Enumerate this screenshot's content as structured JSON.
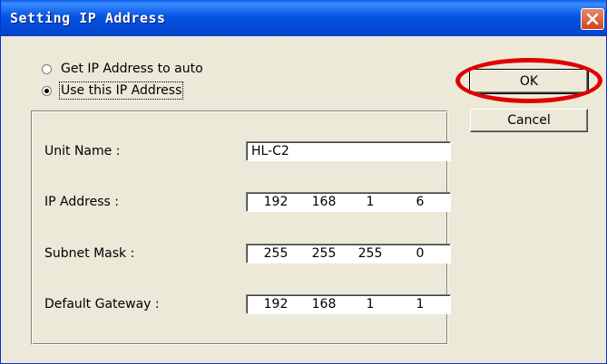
{
  "window": {
    "title": "Setting IP Address"
  },
  "mode": {
    "auto_label": "Get IP Address to auto",
    "manual_label": "Use this IP Address",
    "selected": "manual"
  },
  "fields": {
    "unit_name": {
      "label": "Unit Name :",
      "value": "HL-C2"
    },
    "ip_address": {
      "label": "IP Address :",
      "octets": [
        "192",
        "168",
        "1",
        "6"
      ]
    },
    "subnet_mask": {
      "label": "Subnet Mask :",
      "octets": [
        "255",
        "255",
        "255",
        "0"
      ]
    },
    "default_gateway": {
      "label": "Default Gateway :",
      "octets": [
        "192",
        "168",
        "1",
        "1"
      ]
    }
  },
  "buttons": {
    "ok": "OK",
    "cancel": "Cancel"
  },
  "annotation": {
    "highlight_color": "#e00000",
    "highlights": "ok-button"
  },
  "icons": {
    "close": "close-icon"
  },
  "colors": {
    "titlebar": "#0554e3",
    "dialog_bg": "#ece9d8",
    "close_button": "#d2431a"
  }
}
